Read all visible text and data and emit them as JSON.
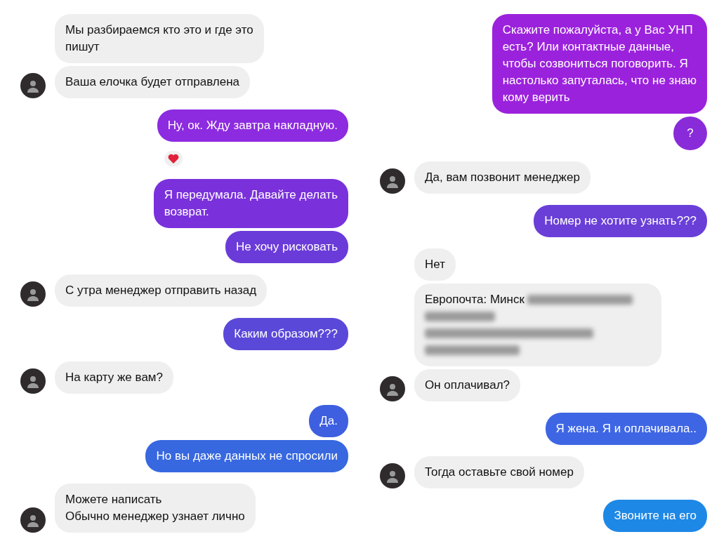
{
  "columns": [
    {
      "groups": [
        {
          "kind": "incoming",
          "avatar": true,
          "messages": [
            {
              "text": "Мы разбираемся кто это и где это\nпишут"
            },
            {
              "text": "Ваша елочка будет отправлена"
            }
          ]
        },
        {
          "kind": "outgoing",
          "messages": [
            {
              "text": "Ну, ок. Жду завтра накладную.",
              "color": "#8d2be0",
              "reaction": true
            }
          ]
        },
        {
          "kind": "outgoing",
          "messages": [
            {
              "text": "Я передумала. Давайте делать\nвозврат.",
              "color": "#7a31dc"
            },
            {
              "text": "Не хочу рисковать",
              "color": "#6b3bd9"
            }
          ]
        },
        {
          "kind": "incoming",
          "avatar": true,
          "messages": [
            {
              "text": "С утра менеджер отправить назад"
            }
          ]
        },
        {
          "kind": "outgoing",
          "messages": [
            {
              "text": "Каким образом???",
              "color": "#5a48d9"
            }
          ]
        },
        {
          "kind": "incoming",
          "avatar": true,
          "messages": [
            {
              "text": "На карту же вам?"
            }
          ]
        },
        {
          "kind": "outgoing",
          "messages": [
            {
              "text": "Да.",
              "color": "#3e5fe0"
            },
            {
              "text": "Но вы даже данных не спросили",
              "color": "#3768e0"
            }
          ]
        },
        {
          "kind": "incoming",
          "avatar": true,
          "messages": [
            {
              "text": "Можете написать\nОбычно менеджер узнает лично"
            }
          ]
        }
      ]
    },
    {
      "groups": [
        {
          "kind": "outgoing",
          "messages": [
            {
              "text": "Скажите пожалуйста, а у Вас УНП\nесть? Или контактные данные,\nчтобы созвониться поговорить. Я\nнастолько запуталась, что не знаю\nкому верить",
              "color": "#9b22dc"
            },
            {
              "text": "?",
              "color": "#8a2bda"
            }
          ]
        },
        {
          "kind": "incoming",
          "avatar": true,
          "messages": [
            {
              "text": "Да, вам позвонит менеджер"
            }
          ]
        },
        {
          "kind": "outgoing",
          "messages": [
            {
              "text": "Номер не хотите узнать???",
              "color": "#6a3fd8"
            }
          ]
        },
        {
          "kind": "incoming",
          "avatar": true,
          "messages": [
            {
              "text": "Нет"
            },
            {
              "text": "Европочта: Минск",
              "redacted": true
            },
            {
              "text": "Он оплачивал?"
            }
          ]
        },
        {
          "kind": "outgoing",
          "messages": [
            {
              "text": "Я жена. Я и оплачивала..",
              "color": "#3e66e4"
            }
          ]
        },
        {
          "kind": "incoming",
          "avatar": true,
          "messages": [
            {
              "text": "Тогда оставьте свой номер"
            }
          ]
        },
        {
          "kind": "outgoing",
          "messages": [
            {
              "text": "Звоните на его",
              "color": "#1e88e6"
            }
          ]
        }
      ]
    }
  ]
}
